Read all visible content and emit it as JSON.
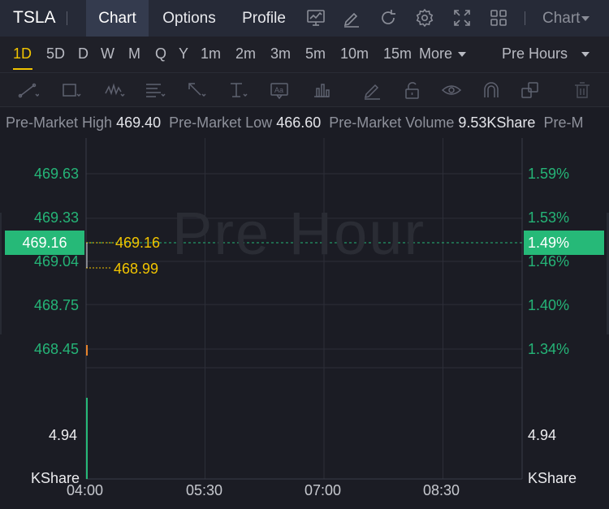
{
  "header": {
    "ticker": "TSLA",
    "tabs": [
      {
        "label": "Chart",
        "active": true
      },
      {
        "label": "Options",
        "active": false
      },
      {
        "label": "Profile",
        "active": false
      }
    ],
    "icons": [
      "chart-monitor-icon",
      "edit-pen-icon",
      "refresh-icon",
      "settings-gear-icon",
      "fullscreen-icon",
      "grid-layout-icon"
    ],
    "chart_type_label": "Chart"
  },
  "periods": {
    "items": [
      "1D",
      "5D",
      "D",
      "W",
      "M",
      "Q",
      "Y",
      "1m",
      "2m",
      "3m",
      "5m",
      "10m",
      "15m"
    ],
    "active": "1D",
    "more_label": "More",
    "session_label": "Pre Hours"
  },
  "tools": [
    "trend-line-icon",
    "rectangle-icon",
    "wave-pattern-icon",
    "fibonacci-icon",
    "arrow-icon",
    "text-marker-icon",
    "text-label-icon",
    "bar-measure-icon",
    "pencil-icon",
    "lock-icon",
    "eye-icon",
    "magnet-icon",
    "copy-icon",
    "trash-icon"
  ],
  "info": {
    "high_label": "Pre-Market High",
    "high_value": "469.40",
    "low_label": "Pre-Market Low",
    "low_value": "466.60",
    "volume_label": "Pre-Market Volume",
    "volume_value": "9.53KShare",
    "more_label": "Pre-M"
  },
  "chart": {
    "watermark": "Pre Hour",
    "current_price": "469.16",
    "current_pct": "1.49%",
    "price_labels": [
      "469.63",
      "469.33",
      "469.04",
      "468.75",
      "468.45"
    ],
    "pct_labels": [
      "1.59%",
      "1.53%",
      "1.46%",
      "1.40%",
      "1.34%"
    ],
    "annotation_top": "469.16",
    "annotation_bottom": "468.99",
    "volume_value_left": "4.94",
    "volume_value_right": "4.94",
    "volume_unit_left": "KShare",
    "volume_unit_right": "KShare",
    "x_labels": [
      "04:00",
      "05:30",
      "07:00",
      "08:30"
    ],
    "colors": {
      "up": "#26b978",
      "annotation": "#f1c400",
      "candle_down": "#e8832b"
    }
  },
  "chart_data": {
    "type": "line",
    "x": [
      "04:00"
    ],
    "series": [
      {
        "values": [
          469.16
        ]
      }
    ],
    "ylim": [
      468.45,
      469.63
    ],
    "yticks": [
      469.63,
      469.33,
      469.04,
      468.75,
      468.45
    ],
    "y_right_ticks_pct": [
      1.59,
      1.53,
      1.46,
      1.4,
      1.34
    ],
    "x_ticks": [
      "04:00",
      "05:30",
      "07:00",
      "08:30"
    ],
    "volume": {
      "x": [
        "04:00"
      ],
      "values": [
        4.94
      ],
      "unit": "KShare"
    }
  }
}
